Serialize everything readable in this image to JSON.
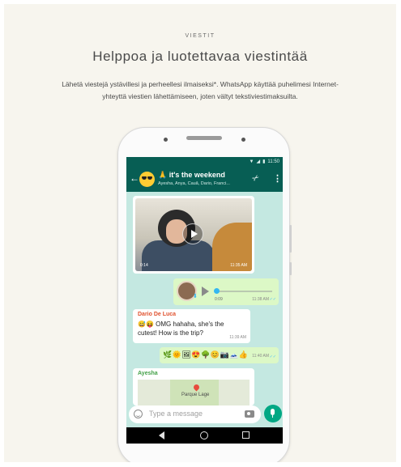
{
  "section": {
    "eyebrow": "VIESTIT",
    "headline": "Helppoa ja luotettavaa viestintää",
    "lead": "Lähetä viestejä ystävillesi ja perheellesi ilmaiseksi*. WhatsApp käyttää puhelimesi Internet-yhteyttä viestien lähettämiseen, joten vältyt tekstiviestimaksuilta."
  },
  "status_bar": {
    "time": "11:50",
    "icons": [
      "wifi-icon",
      "signal-icon",
      "battery-icon"
    ]
  },
  "chat_header": {
    "title": "it's the weekend",
    "title_emoji": "🙏",
    "participants": "Ayesha, Anya, Cauã, Dario, Franci...",
    "avatar": "sunglasses-emoji-avatar",
    "icons": [
      "back-arrow-icon",
      "attach-icon",
      "overflow-menu-icon"
    ]
  },
  "messages": {
    "video": {
      "duration": "0:14",
      "time": "11:35 AM"
    },
    "voice": {
      "duration": "0:09",
      "time": "11:38 AM",
      "progress": 0
    },
    "text": {
      "sender": "Dario De Luca",
      "sender_color": "#e0512e",
      "emoji": "😅😝",
      "body": "OMG hahaha, she's the cutest! How is the trip?",
      "time": "11:39 AM"
    },
    "emoji": {
      "content": "🌿🌞🖼😍🌳😊📷🗻👍",
      "time": "11:40 AM"
    },
    "location": {
      "sender": "Ayesha",
      "sender_color": "#43a047",
      "place": "Parque Lage"
    }
  },
  "composer": {
    "placeholder": "Type a message"
  },
  "colors": {
    "header": "#075e54",
    "chat_bg": "#c4e8e1",
    "outgoing": "#dcf8c6",
    "accent": "#00a884"
  }
}
